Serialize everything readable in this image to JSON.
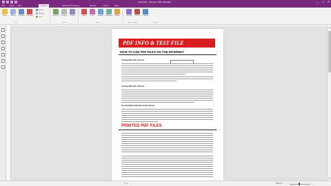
{
  "window": {
    "title": "Foxit PDF - Phantom PDF Standard",
    "minimize": "—",
    "maximize": "□",
    "close": "✕"
  },
  "ribbon_tabs": [
    {
      "label": "File",
      "active": false
    },
    {
      "label": "Home",
      "active": false
    },
    {
      "label": "Edit",
      "active": false
    },
    {
      "label": "Organize",
      "active": true
    },
    {
      "label": "Advanced Processing",
      "active": false
    },
    {
      "label": "Security",
      "active": false
    },
    {
      "label": "Forms",
      "active": false
    },
    {
      "label": "Share",
      "active": false
    }
  ],
  "ribbon": {
    "buttons": [
      {
        "label": "Hand",
        "icon": "hand-icon",
        "color": "#f0c040"
      },
      {
        "label": "Select",
        "icon": "select-icon",
        "color": "#9ab0d8"
      },
      {
        "label": "Link/Note",
        "icon": "link-icon",
        "color": "#6a8cc8"
      },
      {
        "label": "Typewriter",
        "icon": "typewriter-icon",
        "color": "#d05050"
      },
      {
        "label": "Form Fill",
        "icon": "form-icon",
        "color": "#7aa06a"
      },
      {
        "label": "Fit Page",
        "icon": "fit-page-icon",
        "color": "#b8b8b8"
      },
      {
        "label": "Rotate",
        "icon": "rotate-icon",
        "color": "#8c8cc0"
      },
      {
        "label": "Create",
        "icon": "create-icon",
        "color": "#c85050"
      },
      {
        "label": "Insert",
        "icon": "insert-icon",
        "color": "#c06ab0"
      },
      {
        "label": "Headers",
        "icon": "header-icon",
        "color": "#70a0d0"
      },
      {
        "label": "Watermark",
        "icon": "watermark-icon",
        "color": "#70b0a0"
      },
      {
        "label": "Stamp",
        "icon": "stamp-icon",
        "color": "#e0a040"
      },
      {
        "label": "Combine",
        "icon": "combine-icon",
        "color": "#9070c0"
      },
      {
        "label": "Convert",
        "icon": "convert-icon",
        "color": "#b05050"
      },
      {
        "label": "Compare",
        "icon": "compare-icon",
        "color": "#5090c0"
      }
    ],
    "small_items": [
      {
        "label": "Reflow",
        "color": "#6a8cc8"
      },
      {
        "label": "Marquee",
        "color": "#9ab0d8"
      },
      {
        "label": "Zoom",
        "color": "#8ab06a"
      }
    ],
    "groups": [
      "Tools",
      "Zoom",
      "Create",
      "Page Display",
      "Protect"
    ]
  },
  "sidebar": {
    "icons": [
      "bookmark-icon",
      "page-thumbnail-icon",
      "layers-icon",
      "attachment-icon",
      "comment-icon",
      "signature-icon",
      "security-icon"
    ]
  },
  "document": {
    "banner": "PDF INFO & TEST FILE",
    "heading1": "HOW TO USE PDF FILES ON THE INTERNET",
    "sub1": "Viewing PDF Files On-Line",
    "sub2": "Viewing PDF Files Off-Line",
    "sub3": "Downloading Limitations of the Internet",
    "heading2": "PRINTED PDF FILES"
  },
  "status": {
    "page": "1 / 1",
    "zoom": "82.57%"
  }
}
